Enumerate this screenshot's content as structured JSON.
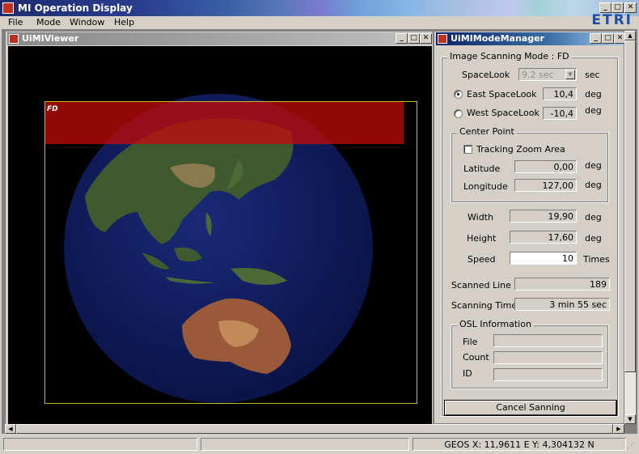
{
  "app": {
    "title": "MI Operation Display",
    "logo": "ETRI",
    "menu": [
      {
        "label": "File",
        "accel": "F"
      },
      {
        "label": "Mode",
        "accel": "M"
      },
      {
        "label": "Window",
        "accel": "W"
      },
      {
        "label": "Help",
        "accel": "H"
      }
    ]
  },
  "window_controls": {
    "minimize": "_",
    "maximize": "□",
    "close": "✕"
  },
  "viewer": {
    "title": "UiMIViewer",
    "mode_label": "FD",
    "colors": {
      "band": "#be0a0a",
      "frame": "#c8b830",
      "ocean": "#0c1a56"
    }
  },
  "manager": {
    "title": "UiMIModeManager",
    "scan_mode_group": "Image Scanning Mode : FD",
    "spacelook": {
      "label": "SpaceLook",
      "value": "9.2 sec",
      "unit": "sec"
    },
    "east": {
      "label": "East SpaceLook",
      "value": "10,4",
      "unit": "deg",
      "selected": true
    },
    "west": {
      "label": "West SpaceLook",
      "value": "-10,4",
      "unit": "deg",
      "selected": false
    },
    "center_point": {
      "group": "Center Point",
      "tracking_label": "Tracking Zoom Area",
      "tracking_checked": false,
      "latitude_label": "Latitude",
      "latitude_value": "0,00",
      "latitude_unit": "deg",
      "longitude_label": "Longitude",
      "longitude_value": "127,00",
      "longitude_unit": "deg"
    },
    "width": {
      "label": "Width",
      "value": "19,90",
      "unit": "deg"
    },
    "height": {
      "label": "Height",
      "value": "17,60",
      "unit": "deg"
    },
    "speed": {
      "label": "Speed",
      "value": "10",
      "unit": "Times"
    },
    "scanned_line": {
      "label": "Scanned Line",
      "value": "189"
    },
    "scanning_time": {
      "label": "Scanning Time",
      "value": "3 min 55 sec"
    },
    "osl": {
      "group": "OSL Information",
      "file_label": "File",
      "file_value": "",
      "count_label": "Count",
      "count_value": "",
      "id_label": "ID",
      "id_value": ""
    },
    "cancel_button": "Cancel Sanning"
  },
  "statusbar": {
    "panel1": "",
    "panel2": "",
    "geos": "GEOS X: 11,9611 E Y: 4,304132 N"
  }
}
